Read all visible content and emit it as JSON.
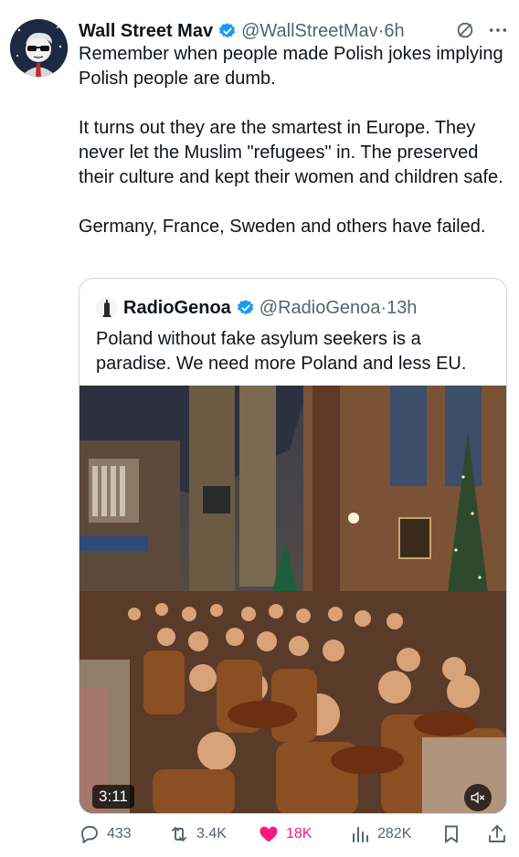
{
  "tweet": {
    "author_name": "Wall Street Mav",
    "handle_time": "@WallStreetMav·6h",
    "text": "Remember when people made Polish jokes implying Polish people are dumb.\n\nIt turns out they are the smartest in Europe. They never let the Muslim \"refugees\" in. The preserved their culture and kept their women and children safe.\n\nGermany, France, Sweden and others have failed."
  },
  "quote": {
    "author_name": "RadioGenoa",
    "handle_time": "@RadioGenoa·13h",
    "text": "Poland without fake asylum seekers is a paradise. We need more Poland and less EU.",
    "video_duration": "3:11"
  },
  "actions": {
    "replies": "433",
    "retweets": "3.4K",
    "likes": "18K",
    "views": "282K"
  },
  "colors": {
    "verified": "#1d9bf0",
    "like": "#f91880",
    "muted_text": "#536471"
  },
  "icons": [
    "grok-icon",
    "more-icon",
    "verified-badge-icon",
    "reply-icon",
    "retweet-icon",
    "like-icon",
    "views-icon",
    "bookmark-icon",
    "share-icon",
    "mute-icon"
  ]
}
